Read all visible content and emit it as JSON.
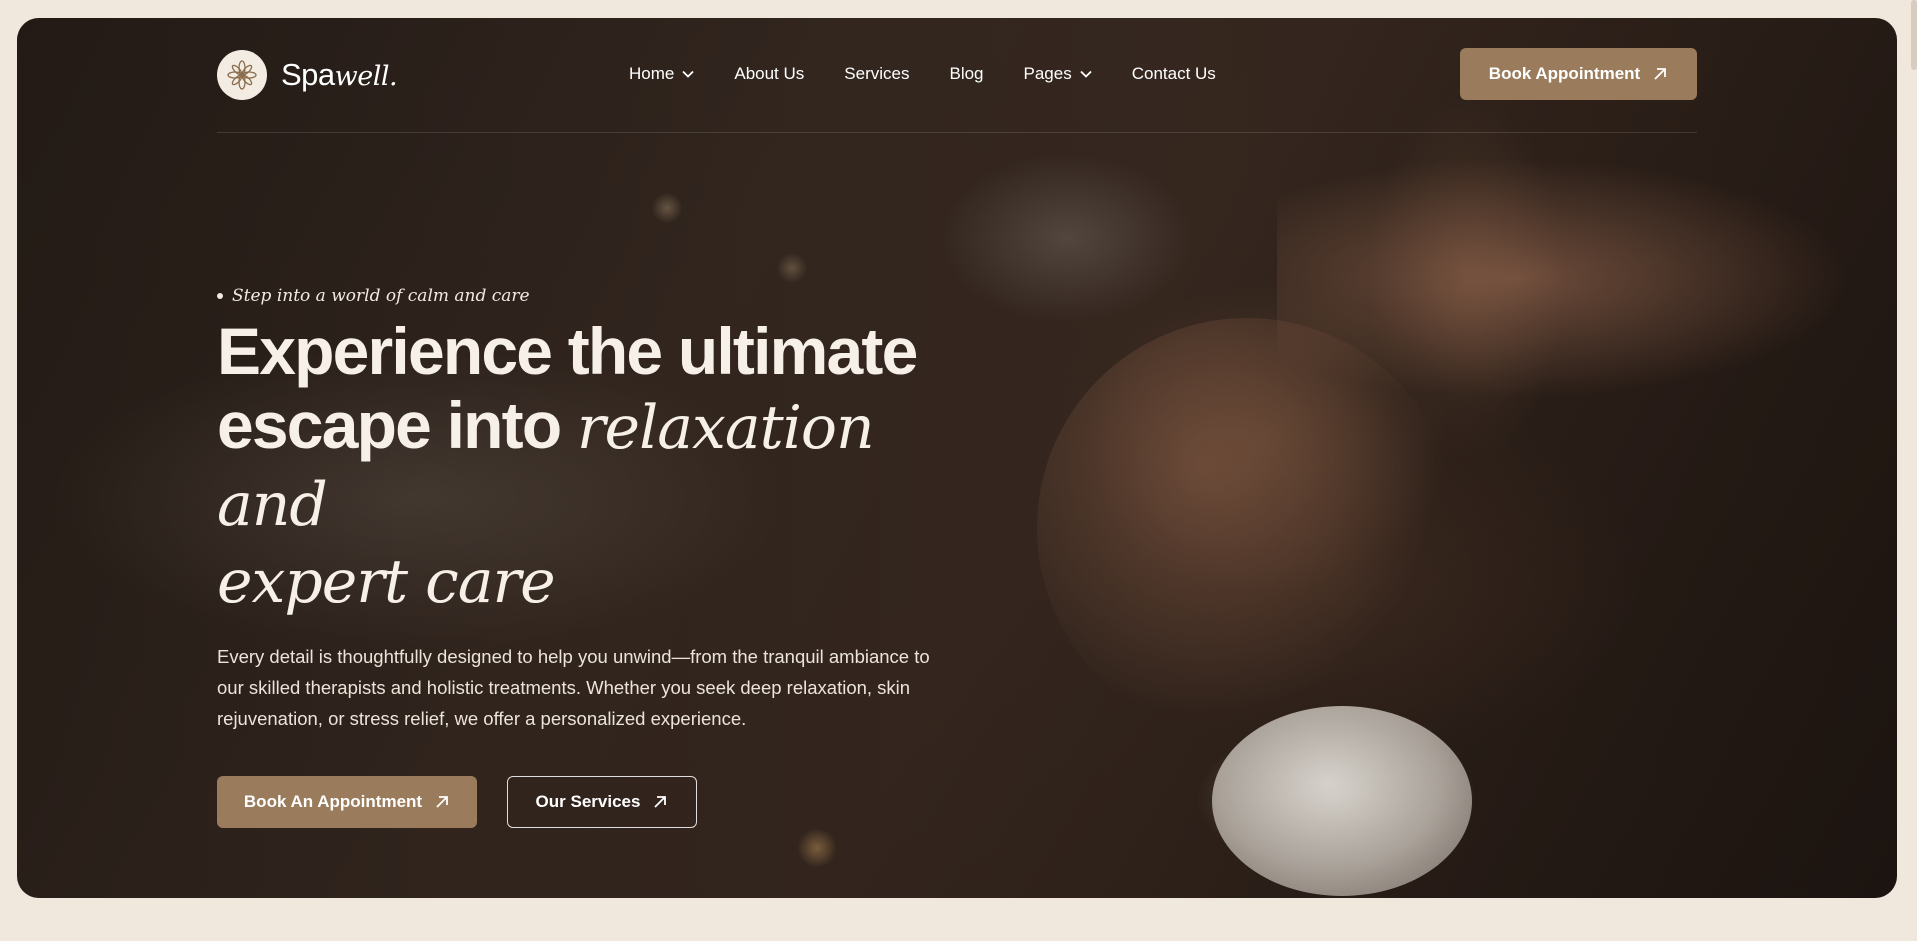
{
  "brand": {
    "name_sans": "Spa",
    "name_serif": "well."
  },
  "nav": {
    "items": [
      {
        "label": "Home",
        "has_dropdown": true
      },
      {
        "label": "About Us",
        "has_dropdown": false
      },
      {
        "label": "Services",
        "has_dropdown": false
      },
      {
        "label": "Blog",
        "has_dropdown": false
      },
      {
        "label": "Pages",
        "has_dropdown": true
      },
      {
        "label": "Contact Us",
        "has_dropdown": false
      }
    ],
    "cta_label": "Book Appointment"
  },
  "hero": {
    "tagline": "Step into a world of calm and care",
    "headline_line1": "Experience the ultimate",
    "headline_line2_sans": "escape into ",
    "headline_line2_serif": "relaxation and",
    "headline_line3_serif": "expert care",
    "description": "Every detail is thoughtfully designed to help you unwind—from the tranquil ambiance to our skilled therapists and holistic treatments. Whether you seek deep relaxation, skin rejuvenation, or stress relief, we offer a personalized experience.",
    "primary_cta": "Book An Appointment",
    "secondary_cta": "Our Services"
  },
  "colors": {
    "accent": "#9a7c5c",
    "page_bg": "#f0e8dc",
    "text_light": "#f6f0e8"
  },
  "icons": {
    "logo": "lotus-flower-icon",
    "dropdown": "chevron-down-icon",
    "arrow": "arrow-up-right-icon"
  }
}
